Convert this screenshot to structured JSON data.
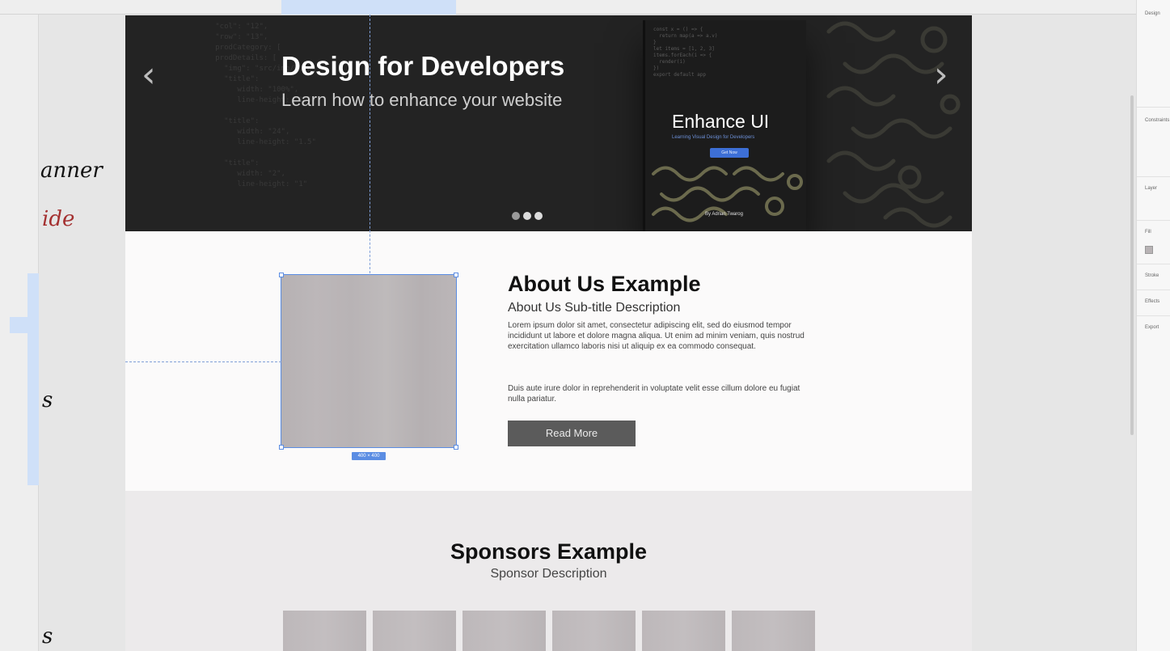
{
  "annotations": [
    "anner",
    "ide",
    "s",
    "s"
  ],
  "banner": {
    "title": "Design for Developers",
    "subtitle": "Learn how to enhance your website",
    "prev_arrow": "‹",
    "next_arrow": "›",
    "book": {
      "title": "Enhance UI",
      "subtitle": "Learning Visual Design for Developers",
      "button": "Get Now",
      "author": "By Adrian Twarog"
    }
  },
  "about": {
    "title": "About Us Example",
    "subtitle": "About Us Sub-title Description",
    "paragraph1": "Lorem ipsum dolor sit amet, consectetur adipiscing elit, sed do eiusmod tempor incididunt ut labore et dolore magna aliqua. Ut enim ad minim veniam, quis nostrud exercitation ullamco laboris nisi ut aliquip ex ea commodo consequat.",
    "paragraph2": "Duis aute irure dolor in reprehenderit in voluptate velit esse cillum dolore eu fugiat nulla pariatur.",
    "button": "Read More",
    "image_size_badge": "400 × 400"
  },
  "sponsors": {
    "title": "Sponsors Example",
    "subtitle": "Sponsor Description"
  },
  "right_panel": {
    "heading": "Design",
    "constraints": "Constraints",
    "layer": "Layer",
    "fill": "Fill",
    "stroke": "Stroke",
    "effects": "Effects",
    "export": "Export"
  },
  "colors": {
    "banner_bg": "#232323",
    "selection": "#5b8de3",
    "button_bg": "#5b5b5b",
    "placeholder": "#b8b3b5"
  }
}
